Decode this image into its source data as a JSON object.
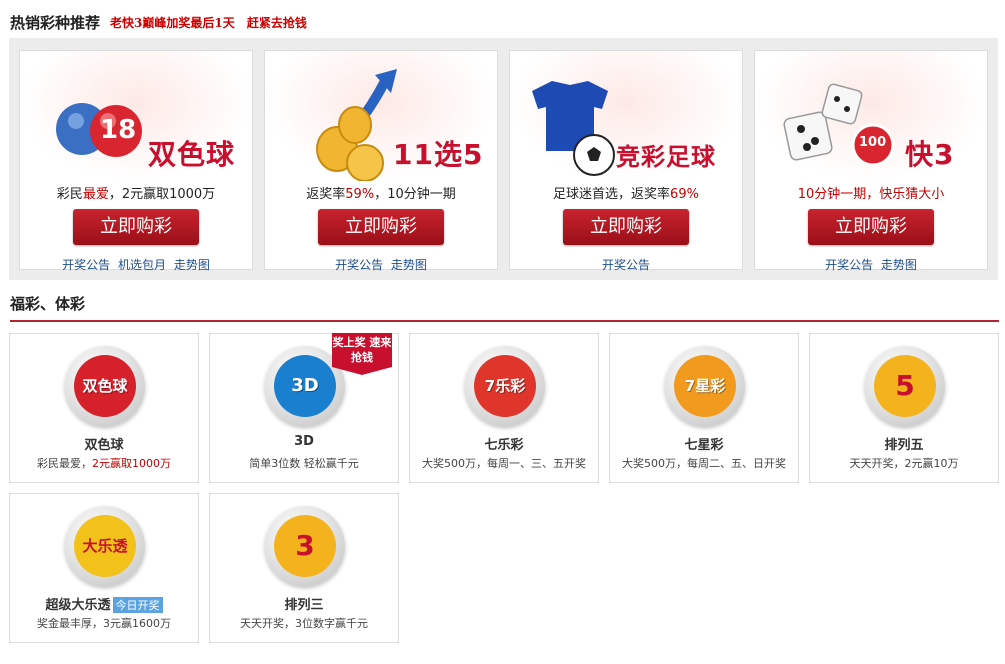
{
  "hot": {
    "title": "热销彩种推荐",
    "promo_text": "老快3巅峰加奖最后1天",
    "promo_link": "赶紧去抢钱",
    "cards": [
      {
        "art_title": "双色球",
        "art_badge": "18",
        "tagline_pre": "彩民",
        "tagline_hl": "最爱",
        "tagline_post": "，2元赢取1000万",
        "buy_label": "立即购彩",
        "links": [
          "开奖公告",
          "机选包月",
          "走势图"
        ]
      },
      {
        "art_title": "11选5",
        "art_badge": "",
        "tagline_pre": "返奖率",
        "tagline_hl": "59%",
        "tagline_post": "，10分钟一期",
        "buy_label": "立即购彩",
        "links": [
          "开奖公告",
          "走势图"
        ]
      },
      {
        "art_title": "竞彩足球",
        "art_badge": "",
        "tagline_pre": "足球迷首选，返奖率",
        "tagline_hl": "69%",
        "tagline_post": "",
        "buy_label": "立即购彩",
        "links": [
          "开奖公告"
        ]
      },
      {
        "art_title": "快3",
        "art_badge": "100",
        "tagline_pre": "10分钟一期，快乐",
        "tagline_hl": "猜大小",
        "tagline_post": "",
        "buy_label": "立即购彩",
        "links": [
          "开奖公告",
          "走势图"
        ]
      }
    ]
  },
  "section": {
    "title": "福彩、体彩"
  },
  "lotteries": [
    {
      "name": "双色球",
      "logo_text": "双色球",
      "desc_pre": "彩民最爱，",
      "desc_hl": "2元赢取1000万",
      "color": "#d6202a",
      "ribbon": "",
      "badge": ""
    },
    {
      "name": "3D",
      "logo_text": "3D",
      "desc_pre": "简单3位数 轻松赢千元",
      "desc_hl": "",
      "color": "#1b7fd0",
      "ribbon": "奖上奖 速来抢钱",
      "badge": ""
    },
    {
      "name": "七乐彩",
      "logo_text": "7乐彩",
      "desc_pre": "大奖500万，每周一、三、五开奖",
      "desc_hl": "",
      "color": "#e0352a",
      "ribbon": "",
      "badge": ""
    },
    {
      "name": "七星彩",
      "logo_text": "7星彩",
      "desc_pre": "大奖500万，每周二、五、日开奖",
      "desc_hl": "",
      "color": "#f29a1e",
      "ribbon": "",
      "badge": ""
    },
    {
      "name": "排列五",
      "logo_text": "5",
      "desc_pre": "天天开奖，2元赢10万",
      "desc_hl": "",
      "color": "#f4b21d",
      "ribbon": "",
      "badge": ""
    },
    {
      "name": "超级大乐透",
      "logo_text": "大乐透",
      "desc_pre": "奖金最丰厚，3元赢1600万",
      "desc_hl": "",
      "color": "#f2c21a",
      "ribbon": "",
      "badge": "今日开奖"
    },
    {
      "name": "排列三",
      "logo_text": "3",
      "desc_pre": "天天开奖，3位数字赢千元",
      "desc_hl": "",
      "color": "#f4b21d",
      "ribbon": "",
      "badge": ""
    }
  ]
}
